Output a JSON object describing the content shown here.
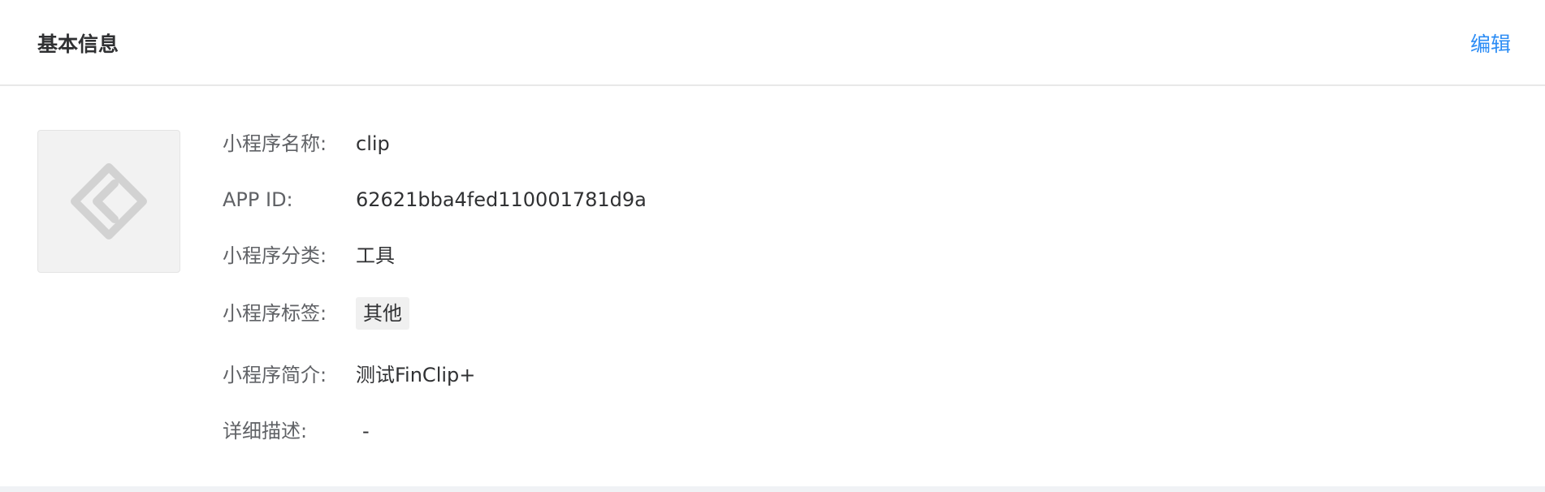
{
  "header": {
    "title": "基本信息",
    "edit_label": "编辑"
  },
  "logo": {
    "icon": "diamond-code-icon",
    "icon_color": "#d2d2d2"
  },
  "info": {
    "name": {
      "label": "小程序名称:",
      "value": "clip"
    },
    "app_id": {
      "label": "APP ID:",
      "value": "62621bba4fed110001781d9a"
    },
    "category": {
      "label": "小程序分类:",
      "value": "工具"
    },
    "tags": {
      "label": "小程序标签:",
      "items": [
        "其他"
      ]
    },
    "intro": {
      "label": "小程序简介:",
      "value": "测试FinClip+"
    },
    "description": {
      "label": "详细描述:",
      "value": "-"
    }
  },
  "colors": {
    "accent": "#2b8cf5",
    "label": "#606266",
    "value": "#303133",
    "tag_bg": "#f0f0f0",
    "page_bg": "#f0f2f5"
  }
}
